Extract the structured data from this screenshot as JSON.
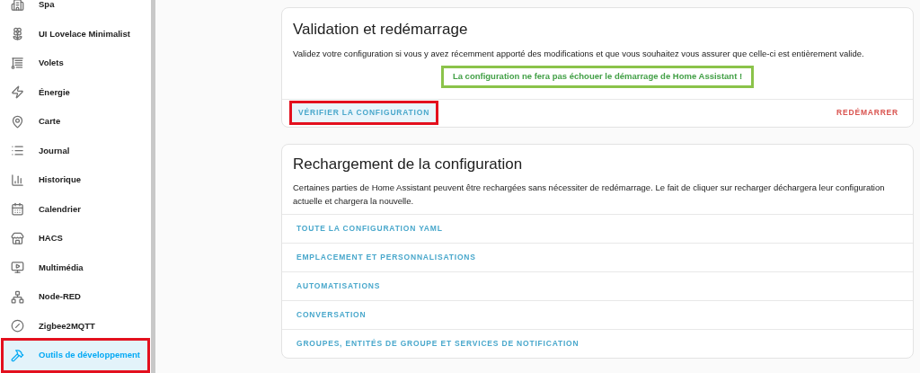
{
  "sidebar": {
    "items": [
      {
        "label": "Spa",
        "selected": false,
        "highlighted": false
      },
      {
        "label": "UI Lovelace Minimalist",
        "selected": false,
        "highlighted": false
      },
      {
        "label": "Volets",
        "selected": false,
        "highlighted": false
      },
      {
        "label": "Énergie",
        "selected": false,
        "highlighted": false
      },
      {
        "label": "Carte",
        "selected": false,
        "highlighted": false
      },
      {
        "label": "Journal",
        "selected": false,
        "highlighted": false
      },
      {
        "label": "Historique",
        "selected": false,
        "highlighted": false
      },
      {
        "label": "Calendrier",
        "selected": false,
        "highlighted": false
      },
      {
        "label": "HACS",
        "selected": false,
        "highlighted": false
      },
      {
        "label": "Multimédia",
        "selected": false,
        "highlighted": false
      },
      {
        "label": "Node-RED",
        "selected": false,
        "highlighted": false
      },
      {
        "label": "Zigbee2MQTT",
        "selected": false,
        "highlighted": false
      },
      {
        "label": "Outils de développement",
        "selected": true,
        "highlighted": true
      }
    ]
  },
  "validation_card": {
    "title": "Validation et redémarrage",
    "description": "Validez votre configuration si vous y avez récemment apporté des modifications et que vous souhaitez vous assurer que celle-ci est entièrement valide.",
    "result": {
      "text": "La configuration ne fera pas échouer le démarrage de Home Assistant !",
      "highlighted": true
    },
    "check_button": {
      "label": "VÉRIFIER LA CONFIGURATION",
      "highlighted": true
    },
    "restart_button": {
      "label": "REDÉMARRER"
    }
  },
  "reload_card": {
    "title": "Rechargement de la configuration",
    "description": "Certaines parties de Home Assistant peuvent être rechargées sans nécessiter de redémarrage. Le fait de cliquer sur recharger déchargera leur configuration actuelle et chargera la nouvelle.",
    "items": [
      "TOUTE LA CONFIGURATION YAML",
      "EMPLACEMENT ET PERSONNALISATIONS",
      "AUTOMATISATIONS",
      "CONVERSATION",
      "GROUPES, ENTITÉS DE GROUPE ET SERVICES DE NOTIFICATION"
    ]
  }
}
